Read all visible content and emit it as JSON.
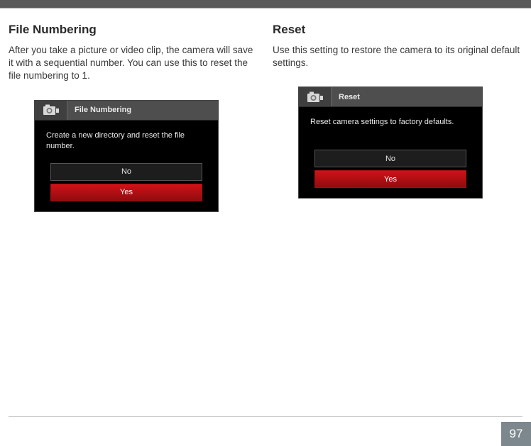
{
  "page_number": "97",
  "left": {
    "title": "File Numbering",
    "desc": "After you take a picture or video clip, the camera will save it with a sequential number. You can use this to reset the file numbering to 1.",
    "dialog": {
      "title": "File Numbering",
      "body": "Create a new directory and reset the file number.",
      "no": "No",
      "yes": "Yes"
    }
  },
  "right": {
    "title": "Reset",
    "desc": "Use this setting to restore the camera to its original default settings.",
    "dialog": {
      "title": "Reset",
      "body": "Reset camera settings to factory defaults.",
      "no": "No",
      "yes": "Yes"
    }
  }
}
